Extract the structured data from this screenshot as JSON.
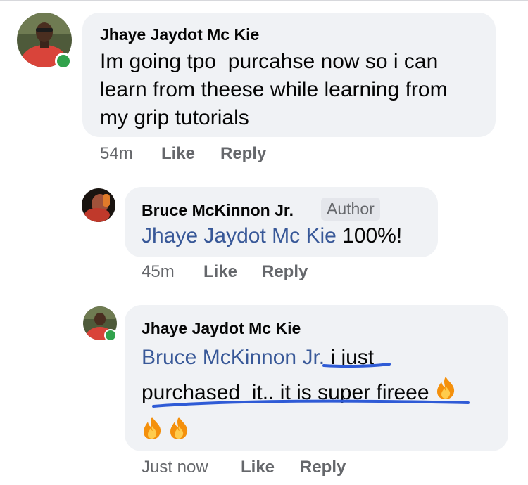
{
  "comments": [
    {
      "author": "Jhaye Jaydot Mc Kie",
      "lines": [
        "Im going tpo  purcahse now so i can",
        "learn from theese while learning from",
        "my grip tutorials"
      ],
      "time": "54m",
      "like": "Like",
      "reply": "Reply",
      "online": true
    },
    {
      "author": "Bruce McKinnon Jr.",
      "badge": "Author",
      "mention": "Jhaye Jaydot Mc Kie",
      "text": " 100%!",
      "time": "45m",
      "like": "Like",
      "reply": "Reply",
      "online": false
    },
    {
      "author": "Jhaye Jaydot Mc Kie",
      "mention": "Bruce McKinnon Jr.",
      "line1_rest": " i just",
      "line2": "purchased  it.. it is super fireee ",
      "emoji": "fire-emoji",
      "time": "Just now",
      "like": "Like",
      "reply": "Reply",
      "online": true
    }
  ],
  "colors": {
    "bubble": "#f0f2f5",
    "mention": "#385898",
    "meta": "#65676b",
    "online": "#31a24c",
    "annotation_ink": "#2f5bd6"
  }
}
